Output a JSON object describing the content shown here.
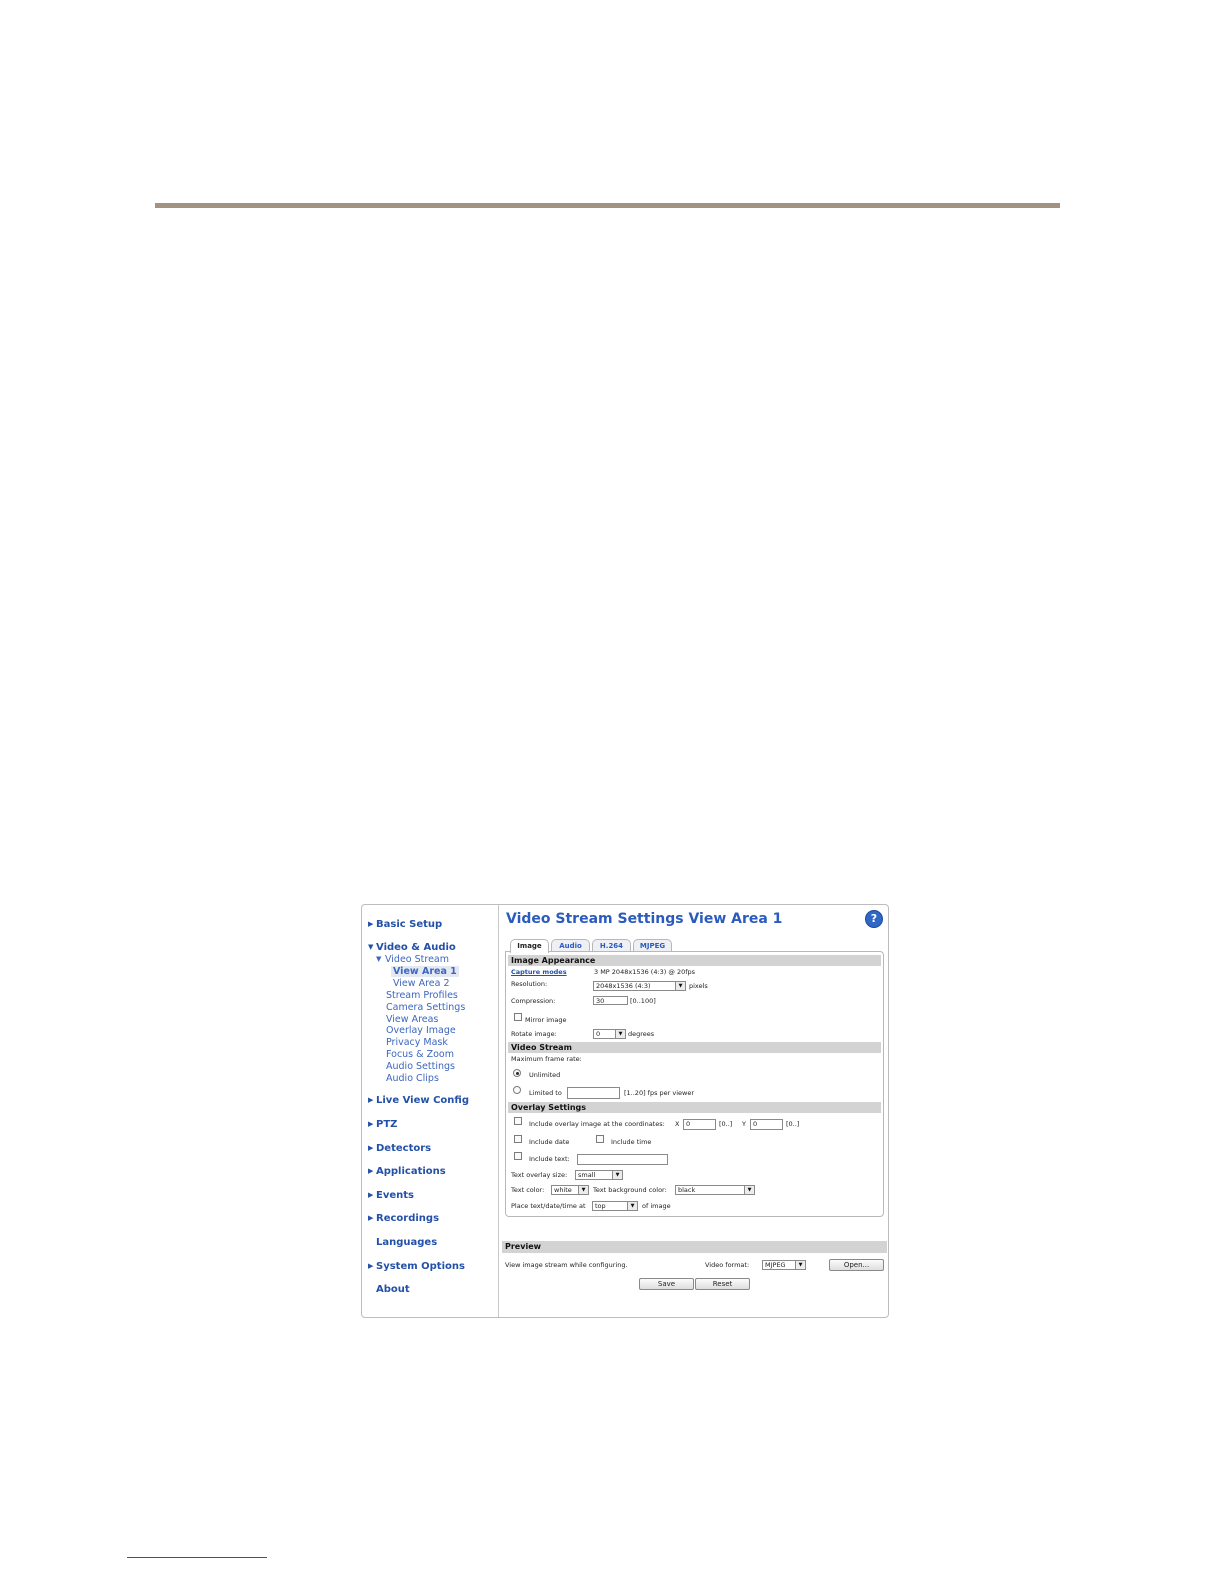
{
  "sidebar": {
    "basic_setup": "Basic Setup",
    "video_audio": "Video & Audio",
    "video_stream": "Video Stream",
    "view_area_1": "View Area 1",
    "view_area_2": "View Area 2",
    "stream_profiles": "Stream Profiles",
    "camera_settings": "Camera Settings",
    "view_areas": "View Areas",
    "overlay_image": "Overlay Image",
    "privacy_mask": "Privacy Mask",
    "focus_zoom": "Focus & Zoom",
    "audio_settings": "Audio Settings",
    "audio_clips": "Audio Clips",
    "live_view_config": "Live View Config",
    "ptz": "PTZ",
    "detectors": "Detectors",
    "applications": "Applications",
    "events": "Events",
    "recordings": "Recordings",
    "languages": "Languages",
    "system_options": "System Options",
    "about": "About"
  },
  "page": {
    "title": "Video Stream Settings View Area 1",
    "help": "?"
  },
  "tabs": {
    "image": "Image",
    "audio": "Audio",
    "h264": "H.264",
    "mjpeg": "MJPEG"
  },
  "appearance": {
    "heading": "Image Appearance",
    "capture_link": "Capture modes",
    "capture_value": "3 MP 2048x1536 (4:3) @ 20fps",
    "resolution_label": "Resolution:",
    "resolution_value": "2048x1536 (4:3)",
    "resolution_unit": "pixels",
    "compression_label": "Compression:",
    "compression_value": "30",
    "compression_range": "[0..100]",
    "mirror_label": "Mirror image",
    "rotate_label": "Rotate image:",
    "rotate_value": "0",
    "rotate_unit": "degrees"
  },
  "stream": {
    "heading": "Video Stream",
    "max_rate_label": "Maximum frame rate:",
    "unlimited": "Unlimited",
    "limited_to": "Limited to",
    "limited_value": "",
    "limited_range": "[1..20] fps per viewer"
  },
  "overlay": {
    "heading": "Overlay Settings",
    "include_image": "Include overlay image at the coordinates:",
    "x_label": "X",
    "x_value": "0",
    "x_range": "[0..]",
    "y_label": "Y",
    "y_value": "0",
    "y_range": "[0..]",
    "include_date": "Include date",
    "include_time": "Include time",
    "include_text": "Include text:",
    "text_value": "",
    "size_label": "Text overlay size:",
    "size_value": "small",
    "color_label": "Text color:",
    "color_value": "white",
    "bg_label": "Text background color:",
    "bg_value": "black",
    "place_label": "Place text/date/time at",
    "place_value": "top",
    "place_suffix": "of image"
  },
  "preview": {
    "heading": "Preview",
    "description": "View image stream while configuring.",
    "format_label": "Video format:",
    "format_value": "MJPEG",
    "open_label": "Open..."
  },
  "actions": {
    "save": "Save",
    "reset": "Reset"
  },
  "colors": {
    "accent": "#2a5bbd",
    "rule": "#a29282",
    "section": "#d3d3d3"
  },
  "icons": {
    "expand": "triangle-right-icon",
    "expanded": "triangle-down-icon",
    "help": "question-circle-icon",
    "dropdown": "chevron-down-icon"
  }
}
